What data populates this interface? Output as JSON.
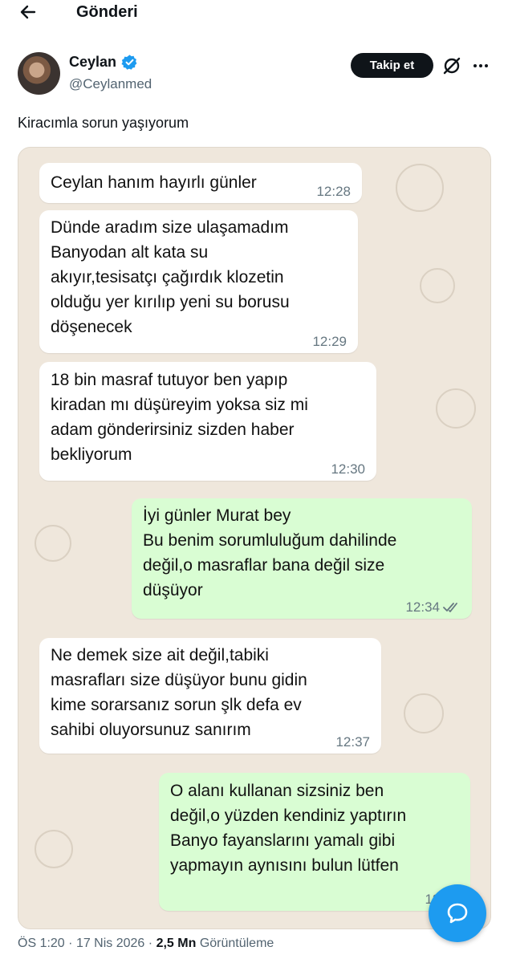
{
  "header": {
    "title": "Gönderi"
  },
  "author": {
    "name": "Ceylan",
    "handle": "@Ceylanmed",
    "follow_label": "Takip et"
  },
  "tweet": {
    "text": "Kiracımla sorun yaşıyorum"
  },
  "chat": {
    "messages": [
      {
        "side": "in",
        "text": "Ceylan hanım hayırlı günler",
        "time": "12:28"
      },
      {
        "side": "in",
        "text": "Dünde aradım size ulaşamadım\nBanyodan alt kata su\nakıyır,tesisatçı çağırdık klozetin\nolduğu yer kırılıp yeni su borusu\ndöşenecek",
        "time": "12:29"
      },
      {
        "side": "in",
        "text": "18 bin masraf tutuyor ben yapıp\nkiradan mı düşüreyim yoksa siz mi\nadam gönderirsiniz sizden haber\nbekliyorum",
        "time": "12:30"
      },
      {
        "side": "out",
        "text": "İyi günler Murat bey\nBu benim sorumluluğum dahilinde\ndeğil,o masraflar bana değil size\ndüşüyor",
        "time": "12:34"
      },
      {
        "side": "in",
        "text": "Ne demek size ait değil,tabiki\nmasrafları size düşüyor bunu gidin\nkime sorarsanız sorun şlk defa ev\nsahibi oluyorsunuz sanırım",
        "time": "12:37"
      },
      {
        "side": "out",
        "text": "O alanı kullanan sizsiniz ben\ndeğil,o yüzden kendiniz yaptırın\nBanyo fayanslarını yamalı gibi\nyapmayın aynısını bulun lütfen",
        "time": "12:38"
      }
    ]
  },
  "footer": {
    "time": "ÖS 1:20",
    "separator": "·",
    "date": "17 Nis 2026",
    "views_count": "2,5 Mn",
    "views_label": "Görüntüleme"
  },
  "icons": {
    "back": "arrow-left-icon",
    "verified": "verified-badge-icon",
    "grok": "grok-icon",
    "more": "more-horizontal-icon",
    "chat": "chat-bubble-icon",
    "read": "double-check-icon"
  },
  "colors": {
    "verified": "#1d9bf0",
    "follow_bg": "#0f1419",
    "incoming_bubble": "#ffffff",
    "outgoing_bubble": "#d9fdd3",
    "chat_bg": "#efe7dc",
    "chat_button": "#1d9bf0"
  }
}
